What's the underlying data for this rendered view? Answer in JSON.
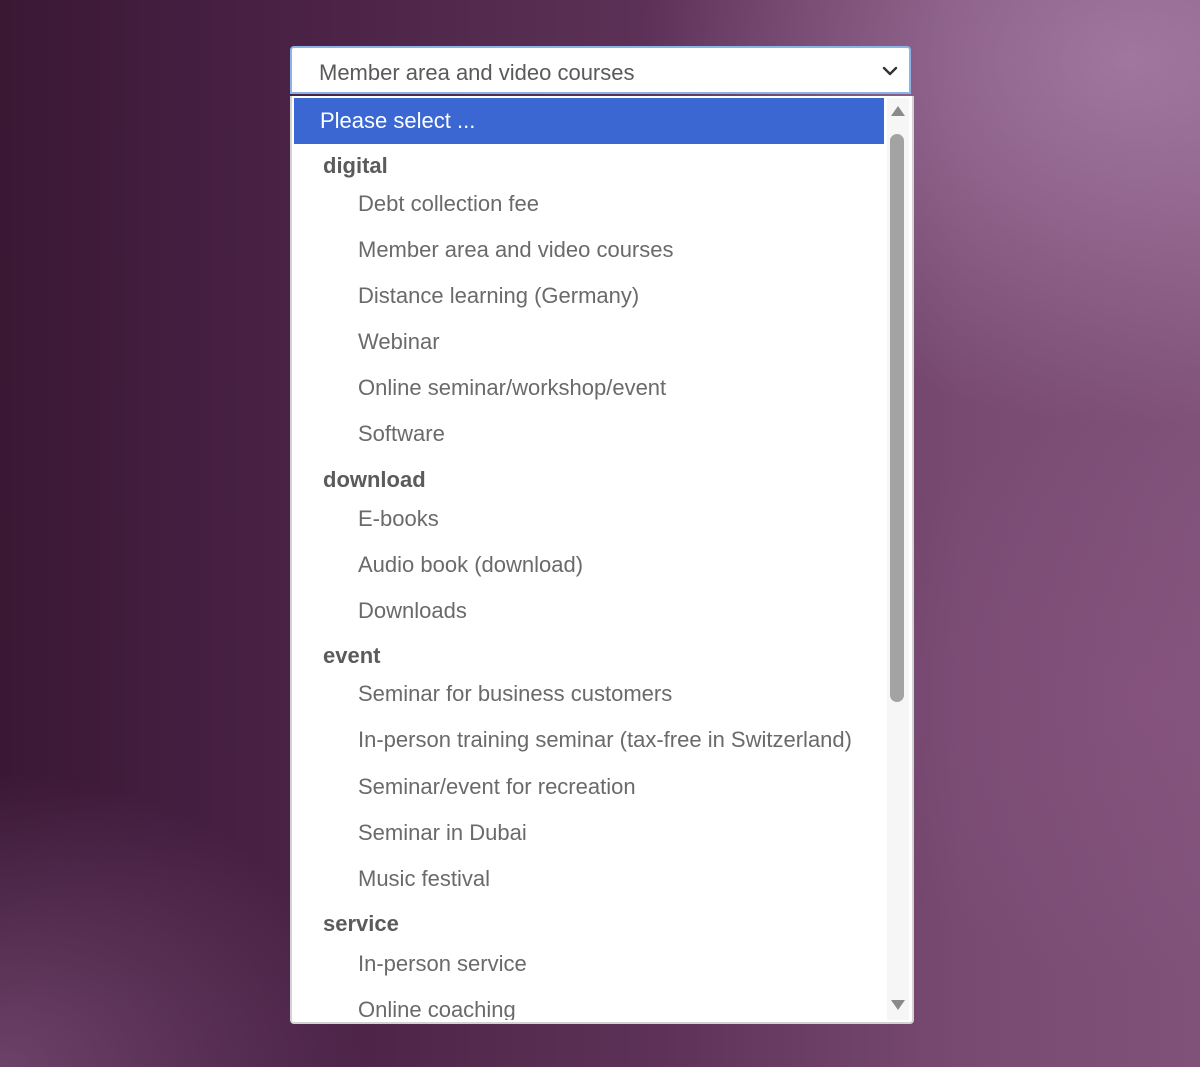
{
  "select": {
    "value": "Member area and video courses",
    "placeholder_option": "Please select ..."
  },
  "groups": [
    {
      "label": "digital",
      "items": [
        "Debt collection fee",
        "Member area and video courses",
        "Distance learning (Germany)",
        "Webinar",
        "Online seminar/workshop/event",
        "Software"
      ]
    },
    {
      "label": "download",
      "items": [
        "E-books",
        "Audio book (download)",
        "Downloads"
      ]
    },
    {
      "label": "event",
      "items": [
        "Seminar for business customers",
        "In-person training seminar (tax-free in Switzerland)",
        "Seminar/event for recreation",
        "Seminar in Dubai",
        "Music festival"
      ]
    },
    {
      "label": "service",
      "items": [
        "In-person service",
        "Online coaching"
      ]
    }
  ],
  "colors": {
    "highlight": "#3a67d2",
    "focus_border": "#8ab4e6",
    "scroll_thumb": "#a3a3a3"
  },
  "icons": {
    "dropdown_toggle": "chevron-down-icon",
    "scroll_up": "scroll-up-arrow-icon",
    "scroll_down": "scroll-down-arrow-icon"
  }
}
